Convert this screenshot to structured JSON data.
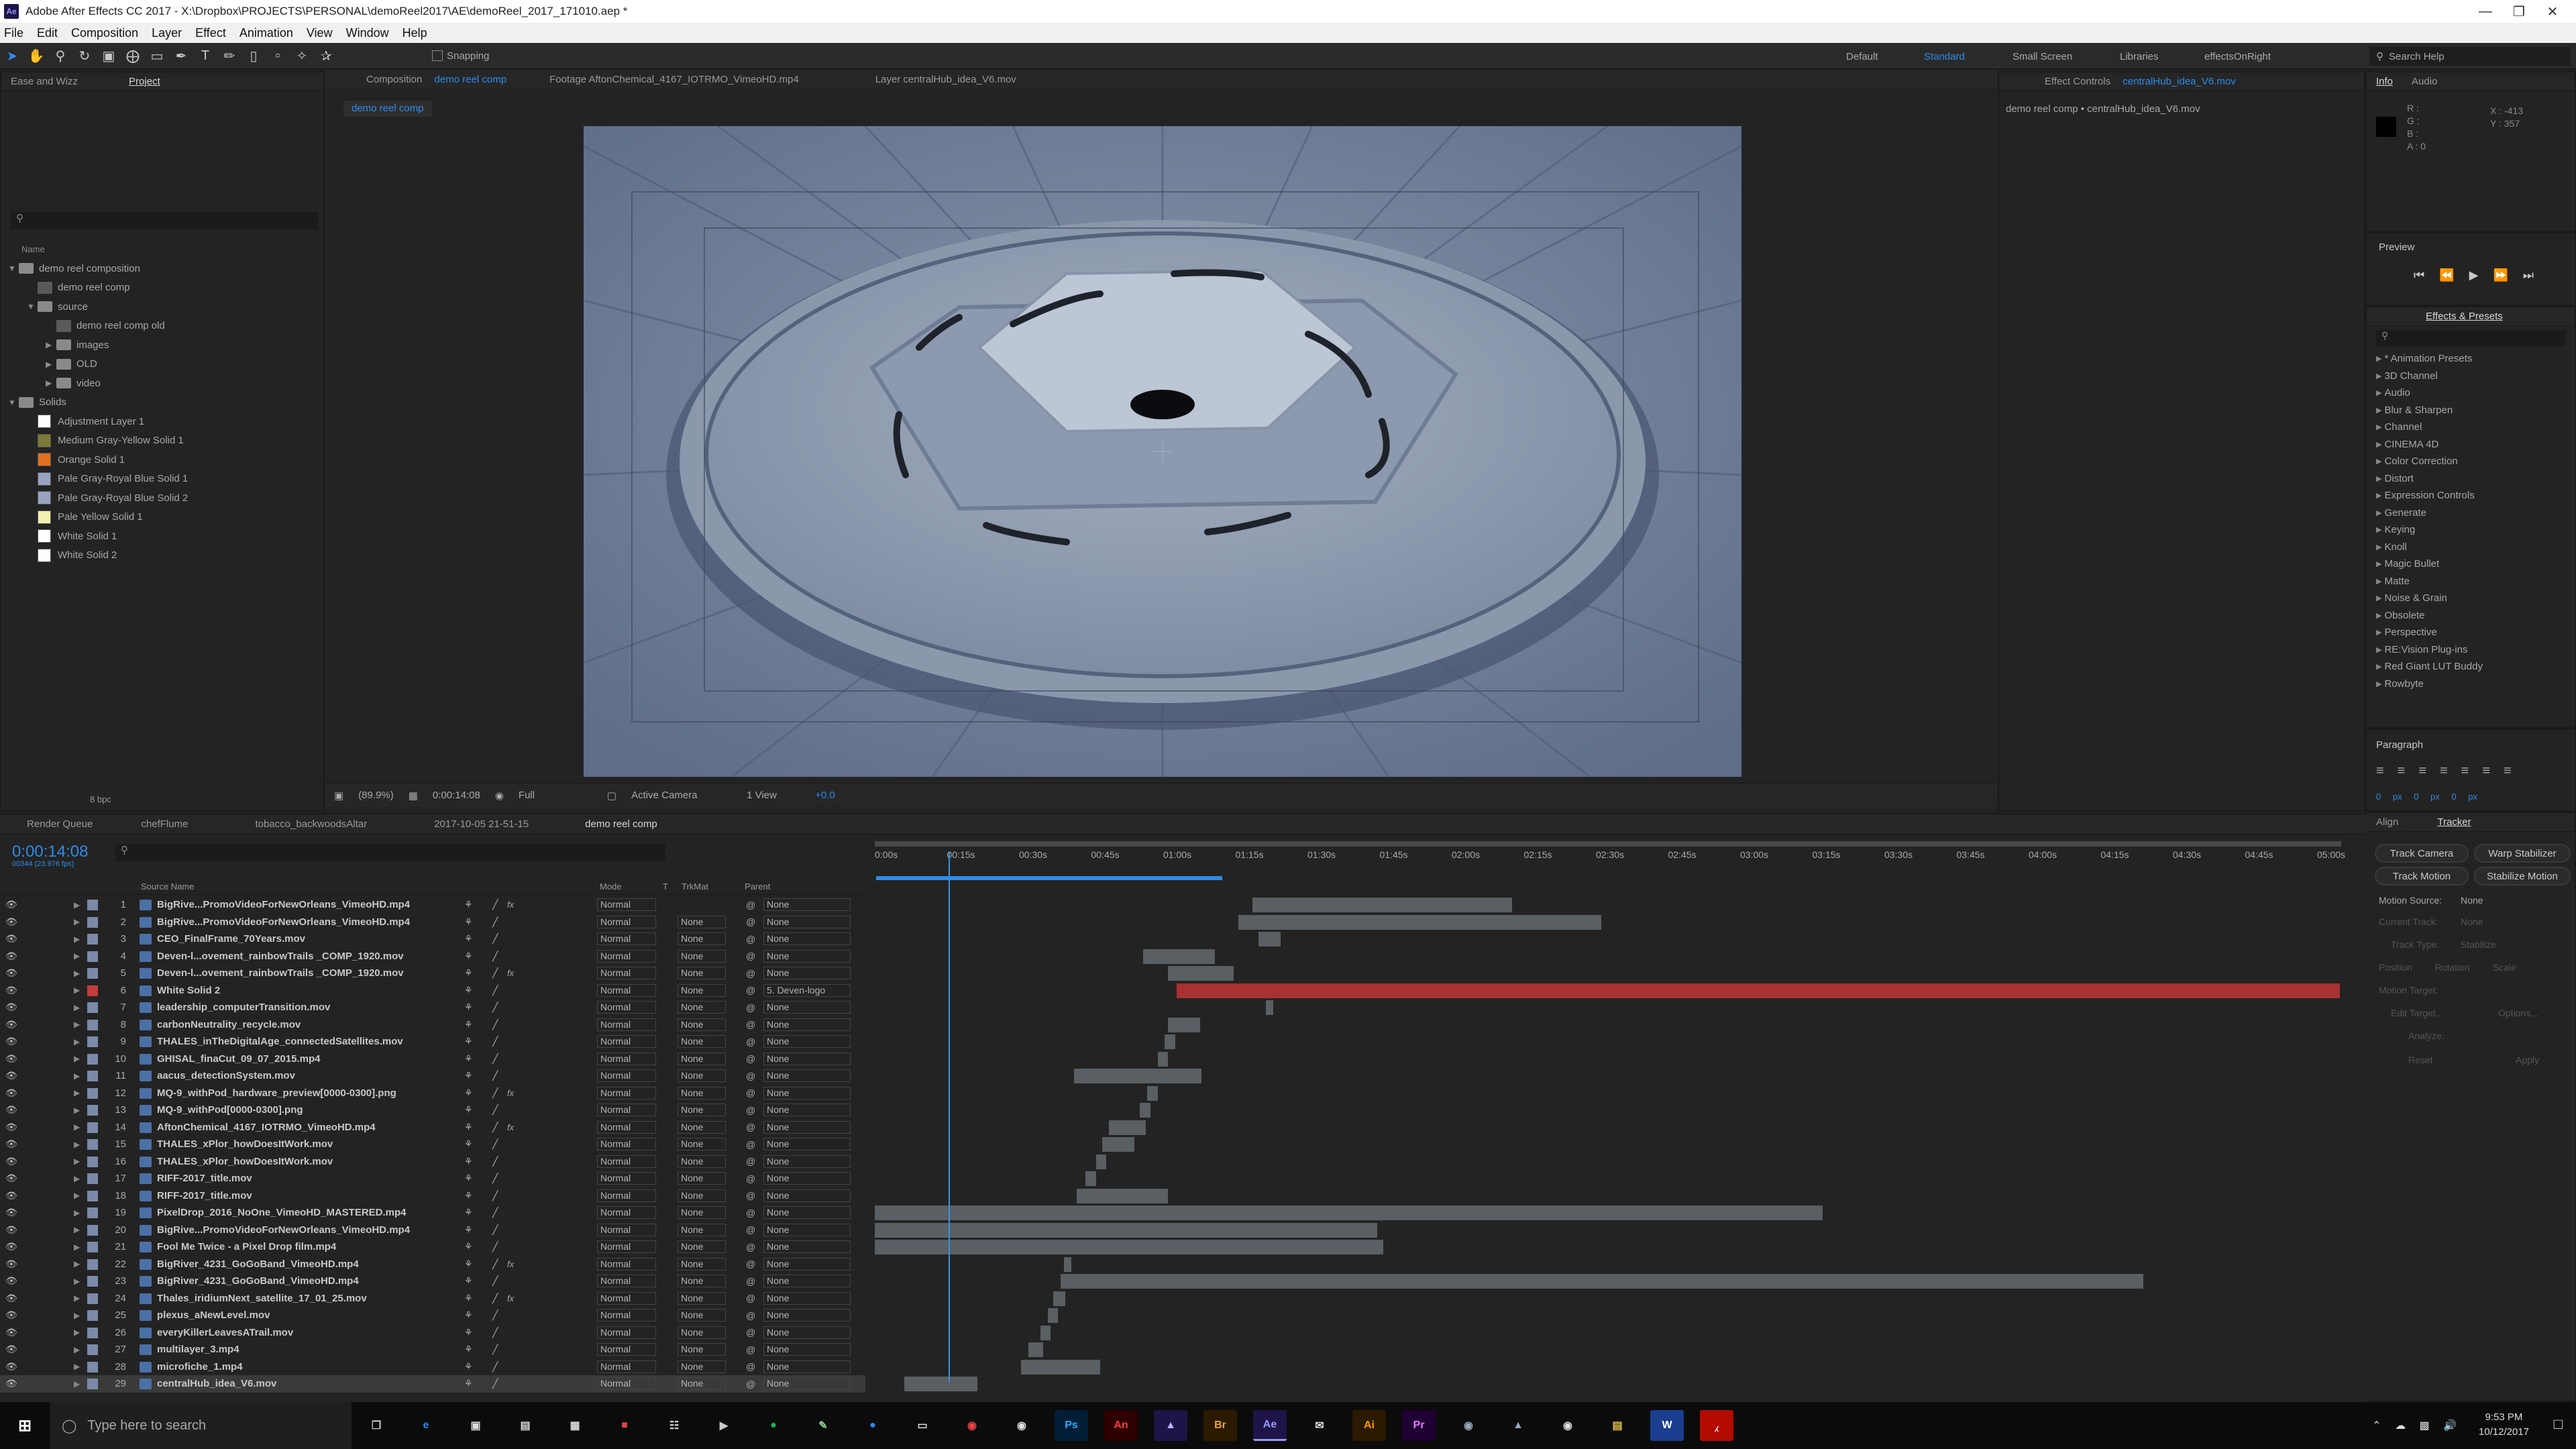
{
  "window": {
    "title": "Adobe After Effects CC 2017 - X:\\Dropbox\\PROJECTS\\PERSONAL\\demoReel2017\\AE\\demoReel_2017_171010.aep *"
  },
  "menu": [
    "File",
    "Edit",
    "Composition",
    "Layer",
    "Effect",
    "Animation",
    "View",
    "Window",
    "Help"
  ],
  "toolbar": {
    "snapping": "Snapping"
  },
  "workspaces": [
    "Default",
    "Standard",
    "Small Screen",
    "Libraries",
    "effectsOnRight"
  ],
  "active_workspace": "Standard",
  "search_help": "Search Help",
  "project": {
    "tabs": [
      "Ease and Wizz",
      "Project"
    ],
    "column": "Name",
    "bpc": "8 bpc",
    "items": [
      {
        "label": "demo reel composition",
        "type": "folder",
        "depth": 0,
        "open": true
      },
      {
        "label": "demo reel comp",
        "type": "comp",
        "depth": 1
      },
      {
        "label": "source",
        "type": "folder",
        "depth": 1,
        "open": true
      },
      {
        "label": "demo reel comp old",
        "type": "comp",
        "depth": 2
      },
      {
        "label": "images",
        "type": "folder",
        "depth": 2
      },
      {
        "label": "OLD",
        "type": "folder",
        "depth": 2
      },
      {
        "label": "video",
        "type": "folder",
        "depth": 2
      },
      {
        "label": "Solids",
        "type": "folder",
        "depth": 0,
        "open": true
      },
      {
        "label": "Adjustment Layer 1",
        "type": "solid",
        "color": "#ffffff",
        "depth": 1
      },
      {
        "label": "Medium Gray-Yellow Solid 1",
        "type": "solid",
        "color": "#7a7a3a",
        "depth": 1
      },
      {
        "label": "Orange Solid 1",
        "type": "solid",
        "color": "#e07020",
        "depth": 1
      },
      {
        "label": "Pale Gray-Royal Blue Solid 1",
        "type": "solid",
        "color": "#9aa3c0",
        "depth": 1
      },
      {
        "label": "Pale Gray-Royal Blue Solid 2",
        "type": "solid",
        "color": "#9aa3c0",
        "depth": 1
      },
      {
        "label": "Pale Yellow Solid 1",
        "type": "solid",
        "color": "#f0f0b0",
        "depth": 1
      },
      {
        "label": "White Solid 1",
        "type": "solid",
        "color": "#ffffff",
        "depth": 1
      },
      {
        "label": "White Solid 2",
        "type": "solid",
        "color": "#ffffff",
        "depth": 1
      }
    ]
  },
  "comp_viewer": {
    "tabs": [
      "Composition demo reel comp",
      "Footage AftonChemical_4167_IOTRMO_VimeoHD.mp4",
      "Layer centralHub_idea_V6.mov"
    ],
    "comp_label_prefix": "Composition",
    "comp_name": "demo reel comp",
    "breadcrumb": "demo reel comp",
    "zoom": "(89.9%)",
    "timecode": "0:00:14:08",
    "resolution": "Full",
    "camera": "Active Camera",
    "views": "1 View",
    "exposure": "+0.0"
  },
  "effect_controls": {
    "tab_prefix": "Effect Controls",
    "tab_layer": "centralHub_idea_V6.mov",
    "path": "demo reel comp • centralHub_idea_V6.mov"
  },
  "info": {
    "tabs": [
      "Info",
      "Audio"
    ],
    "r": "R :",
    "g": "G :",
    "b": "B :",
    "a": "A : 0",
    "x": "X : -413",
    "y": "Y : 357"
  },
  "preview": {
    "title": "Preview"
  },
  "effects_presets": {
    "tab": "Effects & Presets",
    "items": [
      "* Animation Presets",
      "3D Channel",
      "Audio",
      "Blur & Sharpen",
      "Channel",
      "CINEMA 4D",
      "Color Correction",
      "Distort",
      "Expression Controls",
      "Generate",
      "Keying",
      "Knoll",
      "Magic Bullet",
      "Matte",
      "Noise & Grain",
      "Obsolete",
      "Perspective",
      "RE:Vision Plug-ins",
      "Red Giant LUT Buddy",
      "Rowbyte"
    ]
  },
  "paragraph": {
    "title": "Paragraph",
    "indent1": "0 px",
    "indent2": "0 px",
    "indent3": "0 px",
    "space1": "0 px",
    "space2": "0 px"
  },
  "tracker": {
    "tabs": [
      "Align",
      "Tracker"
    ],
    "buttons": [
      "Track Camera",
      "Warp Stabilizer",
      "Track Motion",
      "Stabilize Motion"
    ],
    "motion_source_label": "Motion Source:",
    "motion_source": "None",
    "current_track_label": "Current Track:",
    "current_track": "None",
    "track_type_label": "Track Type:",
    "track_type": "Stabilize",
    "checks": [
      "Position",
      "Rotation",
      "Scale"
    ],
    "motion_target": "Motion Target:",
    "edit_target": "Edit Target...",
    "options": "Options...",
    "analyze": "Analyze:",
    "reset": "Reset",
    "apply": "Apply"
  },
  "timeline": {
    "tabs": [
      "Render Queue",
      "chefFlume",
      "tobacco_backwoodsAltar",
      "2017-10-05 21-51-15",
      "demo reel comp"
    ],
    "timecode": "0:00:14:08",
    "frames": "00344 (23.976 fps)",
    "columns": {
      "source": "Source Name",
      "mode": "Mode",
      "t": "T",
      "trkmat": "TrkMat",
      "parent": "Parent"
    },
    "ruler": [
      "0:00s",
      "00:15s",
      "00:30s",
      "00:45s",
      "01:00s",
      "01:15s",
      "01:30s",
      "01:45s",
      "02:00s",
      "02:15s",
      "02:30s",
      "02:45s",
      "03:00s",
      "03:15s",
      "03:30s",
      "03:45s",
      "04:00s",
      "04:15s",
      "04:30s",
      "04:45s",
      "05:00s"
    ],
    "layers": [
      {
        "n": "1",
        "name": "BigRive...PromoVideoForNewOrleans_VimeoHD.mp4",
        "mode": "Normal",
        "trk": "",
        "parent": "None",
        "fx": true,
        "bar": [
          0.258,
          0.435
        ]
      },
      {
        "n": "2",
        "name": "BigRive...PromoVideoForNewOrleans_VimeoHD.mp4",
        "mode": "Normal",
        "trk": "None",
        "parent": "None",
        "bar": [
          0.248,
          0.496
        ]
      },
      {
        "n": "3",
        "name": "CEO_FinalFrame_70Years.mov",
        "mode": "Normal",
        "trk": "None",
        "parent": "None",
        "bar": [
          0.262,
          0.277
        ]
      },
      {
        "n": "4",
        "name": "Deven-l...ovement_rainbowTrails _COMP_1920.mov",
        "mode": "Normal",
        "trk": "None",
        "parent": "None",
        "bar": [
          0.183,
          0.232
        ]
      },
      {
        "n": "5",
        "name": "Deven-l...ovement_rainbowTrails _COMP_1920.mov",
        "mode": "Normal",
        "trk": "None",
        "parent": "None",
        "fx": true,
        "bar": [
          0.2,
          0.245
        ]
      },
      {
        "n": "6",
        "name": "White Solid 2",
        "mode": "Normal",
        "trk": "None",
        "parent": "5. Deven-logo",
        "bar": [
          0.206,
          1.0
        ],
        "red": true
      },
      {
        "n": "7",
        "name": "leadership_computerTransition.mov",
        "mode": "Normal",
        "trk": "None",
        "parent": "None",
        "bar": [
          0.267,
          0.272
        ]
      },
      {
        "n": "8",
        "name": "carbonNeutrality_recycle.mov",
        "mode": "Normal",
        "trk": "None",
        "parent": "None",
        "bar": [
          0.2,
          0.222
        ]
      },
      {
        "n": "9",
        "name": "THALES_inTheDigitalAge_connectedSatellites.mov",
        "mode": "Normal",
        "trk": "None",
        "parent": "None",
        "bar": [
          0.198,
          0.205
        ]
      },
      {
        "n": "10",
        "name": "GHISAL_finaCut_09_07_2015.mp4",
        "mode": "Normal",
        "trk": "None",
        "parent": "None",
        "bar": [
          0.193,
          0.2
        ]
      },
      {
        "n": "11",
        "name": "aacus_detectionSystem.mov",
        "mode": "Normal",
        "trk": "None",
        "parent": "None",
        "bar": [
          0.136,
          0.223
        ]
      },
      {
        "n": "12",
        "name": "MQ-9_withPod_hardware_preview[0000-0300].png",
        "mode": "Normal",
        "trk": "None",
        "parent": "None",
        "fx": true,
        "bar": [
          0.186,
          0.193
        ]
      },
      {
        "n": "13",
        "name": "MQ-9_withPod[0000-0300].png",
        "mode": "Normal",
        "trk": "None",
        "parent": "None",
        "bar": [
          0.181,
          0.188
        ]
      },
      {
        "n": "14",
        "name": "AftonChemical_4167_IOTRMO_VimeoHD.mp4",
        "mode": "Normal",
        "trk": "None",
        "parent": "None",
        "fx": true,
        "bar": [
          0.16,
          0.185
        ]
      },
      {
        "n": "15",
        "name": "THALES_xPlor_howDoesItWork.mov",
        "mode": "Normal",
        "trk": "None",
        "parent": "None",
        "bar": [
          0.155,
          0.177
        ]
      },
      {
        "n": "16",
        "name": "THALES_xPlor_howDoesItWork.mov",
        "mode": "Normal",
        "trk": "None",
        "parent": "None",
        "bar": [
          0.151,
          0.158
        ]
      },
      {
        "n": "17",
        "name": "RIFF-2017_title.mov",
        "mode": "Normal",
        "trk": "None",
        "parent": "None",
        "bar": [
          0.144,
          0.151
        ]
      },
      {
        "n": "18",
        "name": "RIFF-2017_title.mov",
        "mode": "Normal",
        "trk": "None",
        "parent": "None",
        "bar": [
          0.138,
          0.2
        ]
      },
      {
        "n": "19",
        "name": "PixelDrop_2016_NoOne_VimeoHD_MASTERED.mp4",
        "mode": "Normal",
        "trk": "None",
        "parent": "None",
        "bar": [
          0.0,
          0.647
        ]
      },
      {
        "n": "20",
        "name": "BigRive...PromoVideoForNewOrleans_VimeoHD.mp4",
        "mode": "Normal",
        "trk": "None",
        "parent": "None",
        "bar": [
          0.0,
          0.343
        ]
      },
      {
        "n": "21",
        "name": "Fool Me Twice - a Pixel Drop film.mp4",
        "mode": "Normal",
        "trk": "None",
        "parent": "None",
        "bar": [
          0.0,
          0.347
        ]
      },
      {
        "n": "22",
        "name": "BigRiver_4231_GoGoBand_VimeoHD.mp4",
        "mode": "Normal",
        "trk": "None",
        "parent": "None",
        "fx": true,
        "bar": [
          0.129,
          0.134
        ]
      },
      {
        "n": "23",
        "name": "BigRiver_4231_GoGoBand_VimeoHD.mp4",
        "mode": "Normal",
        "trk": "None",
        "parent": "None",
        "bar": [
          0.127,
          0.866
        ]
      },
      {
        "n": "24",
        "name": "Thales_iridiumNext_satellite_17_01_25.mov",
        "mode": "Normal",
        "trk": "None",
        "parent": "None",
        "fx": true,
        "bar": [
          0.122,
          0.13
        ]
      },
      {
        "n": "25",
        "name": "plexus_aNewLevel.mov",
        "mode": "Normal",
        "trk": "None",
        "parent": "None",
        "bar": [
          0.118,
          0.125
        ]
      },
      {
        "n": "26",
        "name": "everyKillerLeavesATrail.mov",
        "mode": "Normal",
        "trk": "None",
        "parent": "None",
        "bar": [
          0.113,
          0.12
        ]
      },
      {
        "n": "27",
        "name": "multilayer_3.mp4",
        "mode": "Normal",
        "trk": "None",
        "parent": "None",
        "bar": [
          0.105,
          0.115
        ]
      },
      {
        "n": "28",
        "name": "microfiche_1.mp4",
        "mode": "Normal",
        "trk": "None",
        "parent": "None",
        "bar": [
          0.1,
          0.154
        ]
      },
      {
        "n": "29",
        "name": "centralHub_idea_V6.mov",
        "mode": "Normal",
        "trk": "None",
        "parent": "None",
        "bar": [
          0.02,
          0.07
        ],
        "selected": true
      }
    ]
  },
  "taskbar": {
    "search": "Type here to search",
    "time": "9:53 PM",
    "date": "10/12/2017"
  },
  "colors": {
    "accent": "#2d8ceb",
    "playhead": "#3d8fe0",
    "bar": "#595f63",
    "red_bar": "#a83232"
  }
}
